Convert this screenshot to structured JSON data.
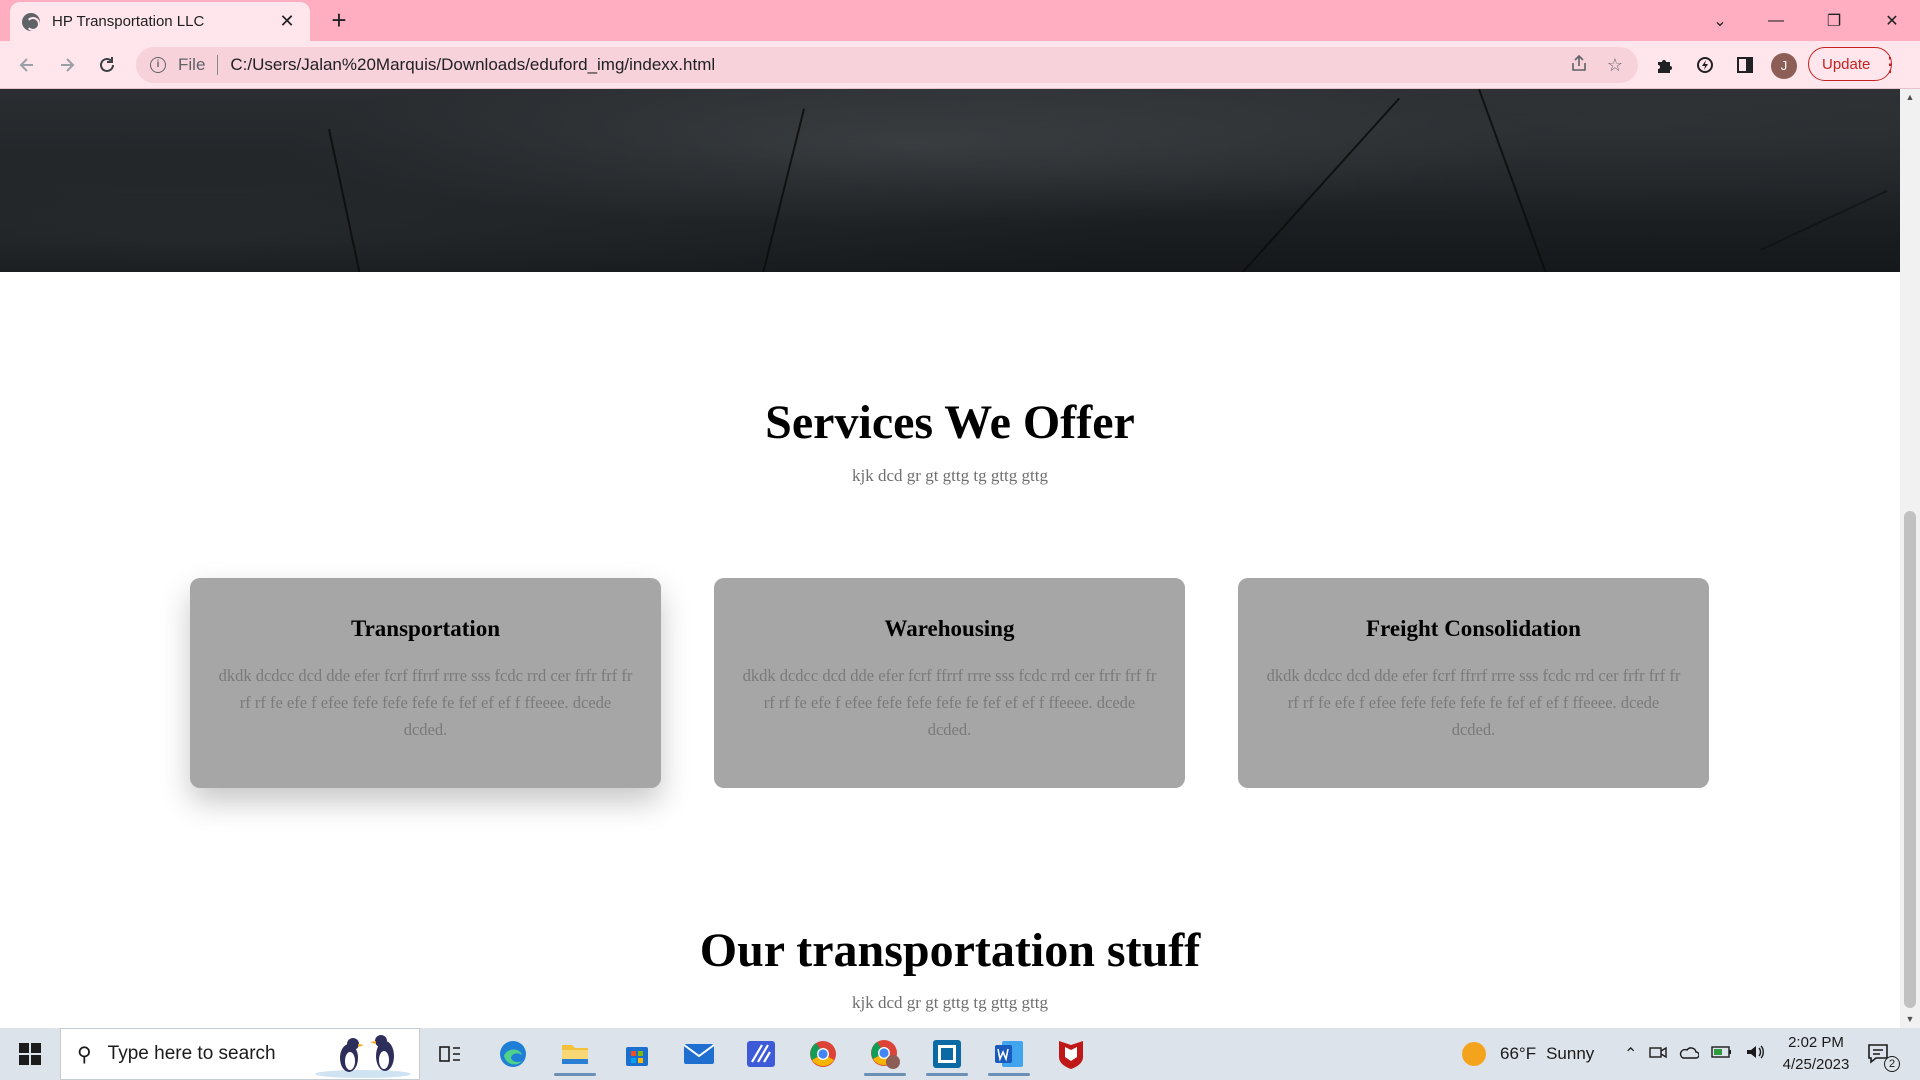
{
  "browser": {
    "tab_title": "HP Transportation LLC",
    "tab_close": "✕",
    "new_tab": "+",
    "window_controls": {
      "dropdown": "⌄",
      "minimize": "—",
      "restore": "❐",
      "close": "✕"
    },
    "address": {
      "scheme": "File",
      "url": "C:/Users/Jalan%20Marquis/Downloads/eduford_img/indexx.html"
    },
    "avatar_initial": "J",
    "update_label": "Update",
    "icons": [
      "back-icon",
      "forward-icon",
      "reload-icon",
      "info-icon",
      "share-icon",
      "star-icon",
      "puzzle-icon",
      "extension-icon",
      "sidepanel-icon",
      "menu-icon"
    ]
  },
  "page": {
    "services": {
      "title": "Services We Offer",
      "subtitle": "kjk dcd gr gt gttg tg gttg gttg",
      "cards": [
        {
          "title": "Transportation",
          "text": "dkdk dcdcc dcd dde efer fcrf ffrrf rrre sss fcdc rrd cer frfr frf fr rf rf fe efe f efee fefe fefe fefe fe fef ef ef f ffeeee. dcede dcded."
        },
        {
          "title": "Warehousing",
          "text": "dkdk dcdcc dcd dde efer fcrf ffrrf rrre sss fcdc rrd cer frfr frf fr rf rf fe efe f efee fefe fefe fefe fe fef ef ef f ffeeee. dcede dcded."
        },
        {
          "title": "Freight Consolidation",
          "text": "dkdk dcdcc dcd dde efer fcrf ffrrf rrre sss fcdc rrd cer frfr frf fr rf rf fe efe f efee fefe fefe fefe fe fef ef ef f ffeeee. dcede dcded."
        }
      ]
    },
    "stuff": {
      "title": "Our transportation stuff",
      "subtitle": "kjk dcd gr gt gttg tg gttg gttg"
    }
  },
  "taskbar": {
    "search_placeholder": "Type here to search",
    "apps": [
      "task-view-icon",
      "edge-icon",
      "file-explorer-icon",
      "store-icon",
      "mail-icon",
      "pen-app-icon",
      "chrome-icon",
      "chrome-profile-icon",
      "terminal-icon",
      "word-icon",
      "mcafee-icon"
    ],
    "weather": {
      "temp": "66°F",
      "condition": "Sunny"
    },
    "time": "2:02 PM",
    "date": "4/25/2023",
    "notifications_count": "2",
    "colors": {
      "accent_underline": "#6b8fb5",
      "sun": "#f4a41c"
    }
  }
}
